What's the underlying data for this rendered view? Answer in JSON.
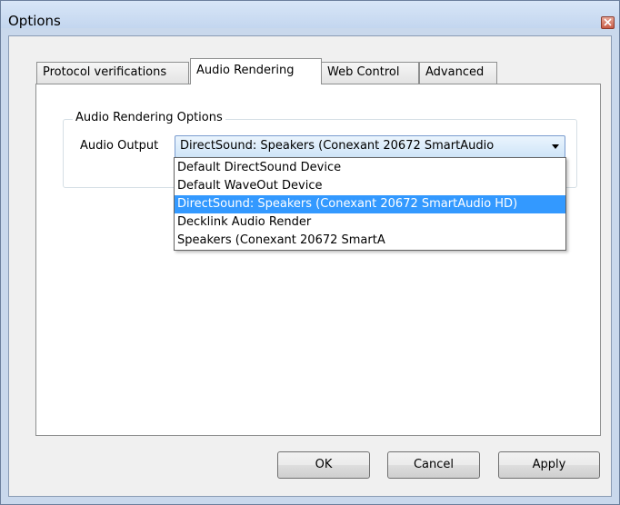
{
  "window": {
    "title": "Options"
  },
  "tabs": [
    {
      "label": "Protocol verifications"
    },
    {
      "label": "Audio Rendering"
    },
    {
      "label": "Web Control"
    },
    {
      "label": "Advanced"
    }
  ],
  "group": {
    "legend": "Audio Rendering Options"
  },
  "audio_output": {
    "label": "Audio Output",
    "selected": "DirectSound: Speakers (Conexant 20672 SmartAudio",
    "options": [
      "Default DirectSound Device",
      "Default WaveOut Device",
      "DirectSound: Speakers (Conexant 20672 SmartAudio HD)",
      "Decklink Audio Render",
      "Speakers (Conexant 20672 SmartA"
    ],
    "highlighted_index": 2
  },
  "buttons": {
    "ok": "OK",
    "cancel": "Cancel",
    "apply": "Apply"
  },
  "colors": {
    "selection": "#3399ff",
    "title_bar": "#c9d8ec",
    "close_button": "#c85b45"
  },
  "icons": {
    "close": "close-icon",
    "dropdown": "chevron-down-icon"
  }
}
